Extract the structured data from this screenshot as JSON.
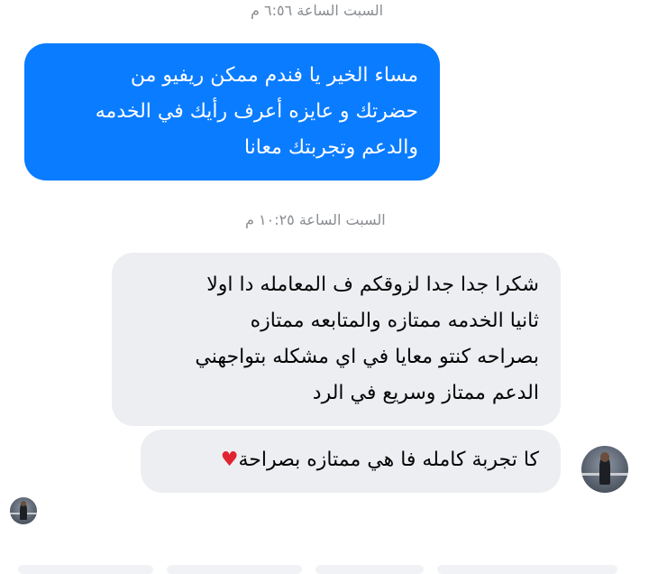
{
  "timestamps": {
    "first": "السبت الساعة ٦:٥٦ م",
    "second": "السبت الساعة ١٠:٢٥ م"
  },
  "outgoing_message": {
    "lines": [
      "مساء الخير يا فندم ممكن ريفيو من",
      "حضرتك و عايزه أعرف رأيك في الخدمه",
      "والدعم وتجربتك معانا"
    ]
  },
  "incoming_message_1": {
    "lines": [
      "شكرا جدا جدا لزوقكم ف المعامله دا اولا",
      "ثانيا الخدمه ممتازه والمتابعه ممتازه",
      "بصراحه كنتو معايا في اي مشكله بتواجهني",
      "الدعم ممتاز وسريع في الرد"
    ]
  },
  "incoming_message_2": {
    "text": "كا تجربة كامله فا هي ممتازه بصراحة",
    "emoji": "♥"
  },
  "colors": {
    "outgoing_bubble": "#0a7cff",
    "incoming_bubble": "#eceef1",
    "timestamp": "#8a8d91",
    "heart": "#e0242f"
  },
  "icons": {
    "contact_avatar": "contact-avatar",
    "seen_indicator": "seen-avatar-icon"
  }
}
